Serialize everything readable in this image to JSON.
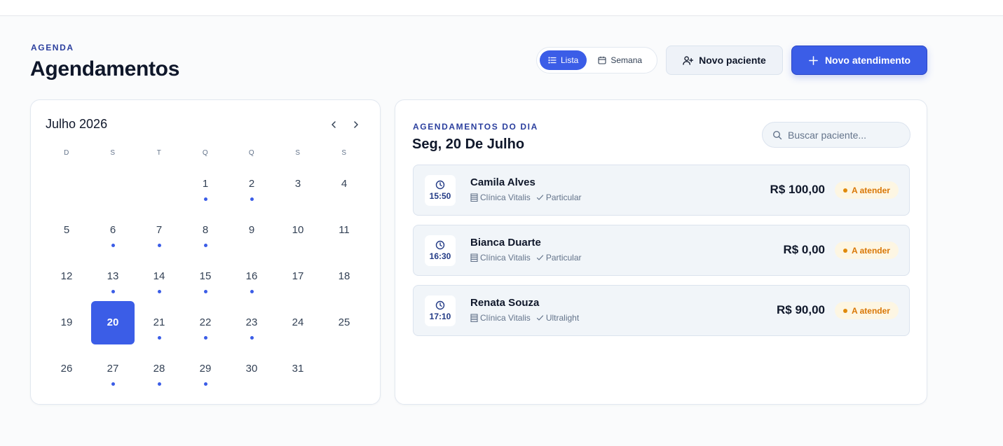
{
  "header": {
    "eyebrow": "AGENDA",
    "title": "Agendamentos",
    "view_toggle": {
      "list_label": "Lista",
      "week_label": "Semana",
      "active": "Lista"
    },
    "new_patient_label": "Novo paciente",
    "new_appointment_label": "Novo atendimento"
  },
  "calendar": {
    "month_label": "Julho 2026",
    "weekdays": [
      "D",
      "S",
      "T",
      "Q",
      "Q",
      "S",
      "S"
    ],
    "selected_day": "20",
    "weeks": [
      [
        {
          "d": ""
        },
        {
          "d": ""
        },
        {
          "d": ""
        },
        {
          "d": "1",
          "dot": true
        },
        {
          "d": "2",
          "dot": true
        },
        {
          "d": "3"
        },
        {
          "d": "4"
        }
      ],
      [
        {
          "d": "5"
        },
        {
          "d": "6",
          "dot": true
        },
        {
          "d": "7",
          "dot": true
        },
        {
          "d": "8",
          "dot": true
        },
        {
          "d": "9"
        },
        {
          "d": "10"
        },
        {
          "d": "11"
        }
      ],
      [
        {
          "d": "12"
        },
        {
          "d": "13",
          "dot": true
        },
        {
          "d": "14",
          "dot": true
        },
        {
          "d": "15",
          "dot": true
        },
        {
          "d": "16",
          "dot": true
        },
        {
          "d": "17"
        },
        {
          "d": "18"
        }
      ],
      [
        {
          "d": "19"
        },
        {
          "d": "20",
          "selected": true
        },
        {
          "d": "21",
          "dot": true
        },
        {
          "d": "22",
          "dot": true
        },
        {
          "d": "23",
          "dot": true
        },
        {
          "d": "24"
        },
        {
          "d": "25"
        }
      ],
      [
        {
          "d": "26"
        },
        {
          "d": "27",
          "dot": true
        },
        {
          "d": "28",
          "dot": true
        },
        {
          "d": "29",
          "dot": true
        },
        {
          "d": "30"
        },
        {
          "d": "31"
        },
        {
          "d": ""
        }
      ]
    ]
  },
  "appointments": {
    "eyebrow": "AGENDAMENTOS DO DIA",
    "date_label": "Seg, 20 De Julho",
    "search_placeholder": "Buscar paciente...",
    "items": [
      {
        "time": "15:50",
        "name": "Camila Alves",
        "clinic": "Clínica Vitalis",
        "plan": "Particular",
        "price": "R$ 100,00",
        "status": "A atender"
      },
      {
        "time": "16:30",
        "name": "Bianca Duarte",
        "clinic": "Clínica Vitalis",
        "plan": "Particular",
        "price": "R$ 0,00",
        "status": "A atender"
      },
      {
        "time": "17:10",
        "name": "Renata Souza",
        "clinic": "Clínica Vitalis",
        "plan": "Ultralight",
        "price": "R$ 90,00",
        "status": "A atender"
      }
    ]
  },
  "colors": {
    "accent": "#3b5de7",
    "eyebrow": "#2b3f9e",
    "status_text": "#d97706",
    "status_bg": "#fdf6e3"
  },
  "icons": {
    "list": "list-icon",
    "calendar": "calendar-icon",
    "add_user": "user-plus-icon",
    "plus": "plus-icon",
    "prev": "chevron-left-icon",
    "next": "chevron-right-icon",
    "search": "search-icon",
    "clock": "clock-icon",
    "building": "building-icon",
    "check": "check-icon"
  }
}
